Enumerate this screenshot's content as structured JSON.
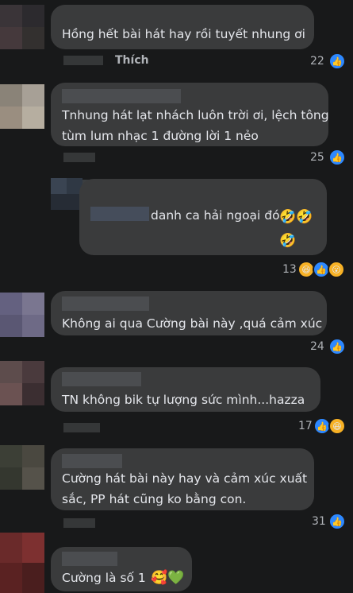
{
  "comments": [
    {
      "text": "Hồng hết bài hát hay rồi tuyết nhung ơi",
      "count": "22",
      "reactions": [
        "like"
      ]
    },
    {
      "text": "Tnhung hát lạt nhách luôn trời ơi, lệch tông\ntùm lum nhạc 1 đường lời 1 nẻo",
      "count": "25",
      "reactions": [
        "like"
      ]
    },
    {
      "text": "danh ca hải ngoại đó",
      "emoji": "🤣🤣\n🤣",
      "count": "13",
      "reactions": [
        "haha",
        "like",
        "wow"
      ]
    },
    {
      "text": "Không ai qua Cường bài này ,quá cảm xúc",
      "count": "24",
      "reactions": [
        "like"
      ]
    },
    {
      "text": "TN không bik tự lượng sức mình...hazza",
      "count": "17",
      "reactions": [
        "like",
        "haha"
      ]
    },
    {
      "text": "Cường hát bài này hay và cảm xúc xuất\nsắc, PP hát cũng ko bằng con.",
      "count": "31",
      "reactions": [
        "like"
      ]
    },
    {
      "text": "Cường là số 1",
      "emoji": "🥰💚"
    }
  ],
  "like_label": "Thích",
  "colors": {
    "background": "#18191a",
    "bubble": "#3a3b3c",
    "like_blue": "#2d88ff",
    "haha_yellow": "#f7b125"
  }
}
